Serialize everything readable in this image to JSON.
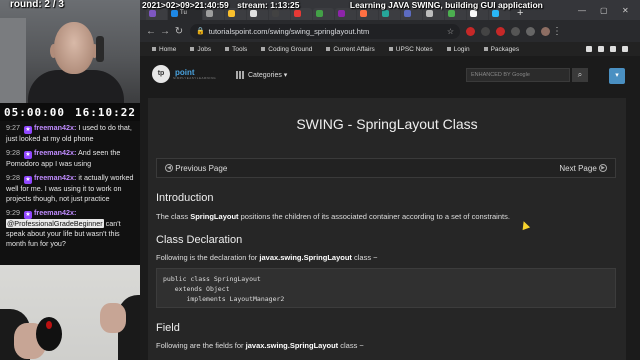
{
  "stream": {
    "round_text": "round: 2 / 3",
    "timer_left": "05:00:00",
    "timer_right": "16:10:22",
    "overlay_datetime": "2021>02>09>21:40:59",
    "overlay_uptime": "stream: 1:13:25",
    "overlay_title": "Learning JAVA SWING, building GUI application"
  },
  "chat": {
    "messages": [
      {
        "time": "9:27",
        "user": "freeman42x:",
        "text": "I used to do that, just looked at my old phone"
      },
      {
        "time": "9:28",
        "user": "freeman42x:",
        "text": "And seen the Pomodoro app I was using"
      },
      {
        "time": "9:28",
        "user": "freeman42x:",
        "text": "it actually worked well for me. I was using it to work on projects though, not just practice"
      },
      {
        "time": "9:29",
        "user": "freeman42x:",
        "mention": "@ProfessionalGradeBeginner",
        "text": "can't speak about your life but wasn't this month fun for you?"
      }
    ]
  },
  "browser": {
    "tab_active_label": "Tu",
    "url": "tutorialspoint.com/swing/swing_springlayout.htm",
    "colors": {
      "accent": "#4aa3df",
      "menu_button": "#4a90c2",
      "tab_strip": "#35363a"
    }
  },
  "site": {
    "nav": [
      "Home",
      "Jobs",
      "Tools",
      "Coding Ground",
      "Current Affairs",
      "UPSC Notes",
      "Login",
      "Packages"
    ],
    "logo_mark": "tp",
    "logo_name": "point",
    "logo_tagline": "SIMPLYEASYLEARNING",
    "categories_label": "Categories ▾",
    "search_placeholder": "ENHANCED BY Google"
  },
  "article": {
    "title": "SWING - SpringLayout Class",
    "prev_label": "Previous Page",
    "next_label": "Next Page",
    "intro_heading": "Introduction",
    "intro_pre": "The class ",
    "intro_bold": "SpringLayout",
    "intro_post": " positions the children of its associated container according to a set of constraints.",
    "decl_heading": "Class Declaration",
    "decl_pre": "Following is the declaration for ",
    "decl_bold": "javax.swing.SpringLayout",
    "decl_post": " class −",
    "code": "public class SpringLayout\n   extends Object\n      implements LayoutManager2",
    "field_heading": "Field",
    "field_pre": "Following are the fields for ",
    "field_bold": "javax.swing.SpringLayout",
    "field_post": " class −"
  }
}
